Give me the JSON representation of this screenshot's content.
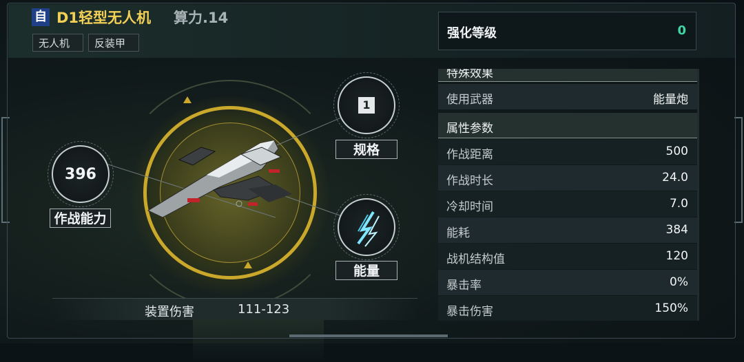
{
  "header": {
    "tier_badge": "自",
    "title": "D1轻型无人机",
    "power": "算力.14",
    "tags": [
      "无人机",
      "反装甲"
    ]
  },
  "enhance": {
    "label": "强化等级",
    "value": "0"
  },
  "stats": {
    "cut_section": "特殊效果",
    "weapon_label": "使用武器",
    "weapon_value": "能量炮",
    "section_title": "属性参数",
    "rows": [
      {
        "label": "作战距离",
        "value": "500"
      },
      {
        "label": "作战时长",
        "value": "24.0"
      },
      {
        "label": "冷却时间",
        "value": "7.0"
      },
      {
        "label": "能耗",
        "value": "384"
      },
      {
        "label": "战机结构值",
        "value": "120"
      },
      {
        "label": "暴击率",
        "value": "0%"
      },
      {
        "label": "暴击伤害",
        "value": "150%"
      }
    ]
  },
  "showcase": {
    "combat_value": "396",
    "combat_label": "作战能力",
    "spec_value": "1",
    "spec_label": "规格",
    "energy_label": "能量",
    "energy_icon": "energy-claw-icon"
  },
  "damage": {
    "label": "装置伤害",
    "value": "111-123"
  },
  "colors": {
    "title": "#f2cf55",
    "enhance_value": "#3fd8a4",
    "ring": "#c9a82c",
    "badge": "#1f3f86"
  }
}
